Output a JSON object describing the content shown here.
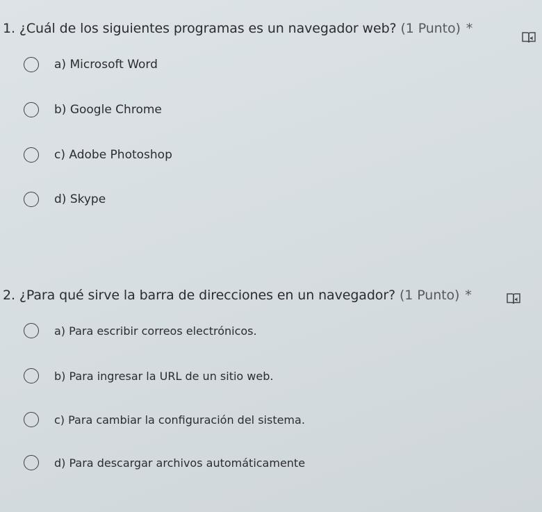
{
  "questions": [
    {
      "number": "1.",
      "text": "¿Cuál de los siguientes programas es un navegador web?",
      "points": "(1 Punto)",
      "required_mark": "*",
      "reader_icon": "immersive-reader-icon",
      "options": [
        "a) Microsoft Word",
        "b) Google Chrome",
        "c) Adobe Photoshop",
        "d) Skype"
      ]
    },
    {
      "number": "2.",
      "text": "¿Para qué sirve la barra de direcciones en un navegador?",
      "points": "(1 Punto)",
      "required_mark": "*",
      "reader_icon": "immersive-reader-icon",
      "options": [
        "a) Para escribir correos electrónicos.",
        "b) Para ingresar la URL de un sitio web.",
        "c) Para cambiar la configuración del sistema.",
        "d) Para descargar archivos automáticamente"
      ]
    }
  ]
}
